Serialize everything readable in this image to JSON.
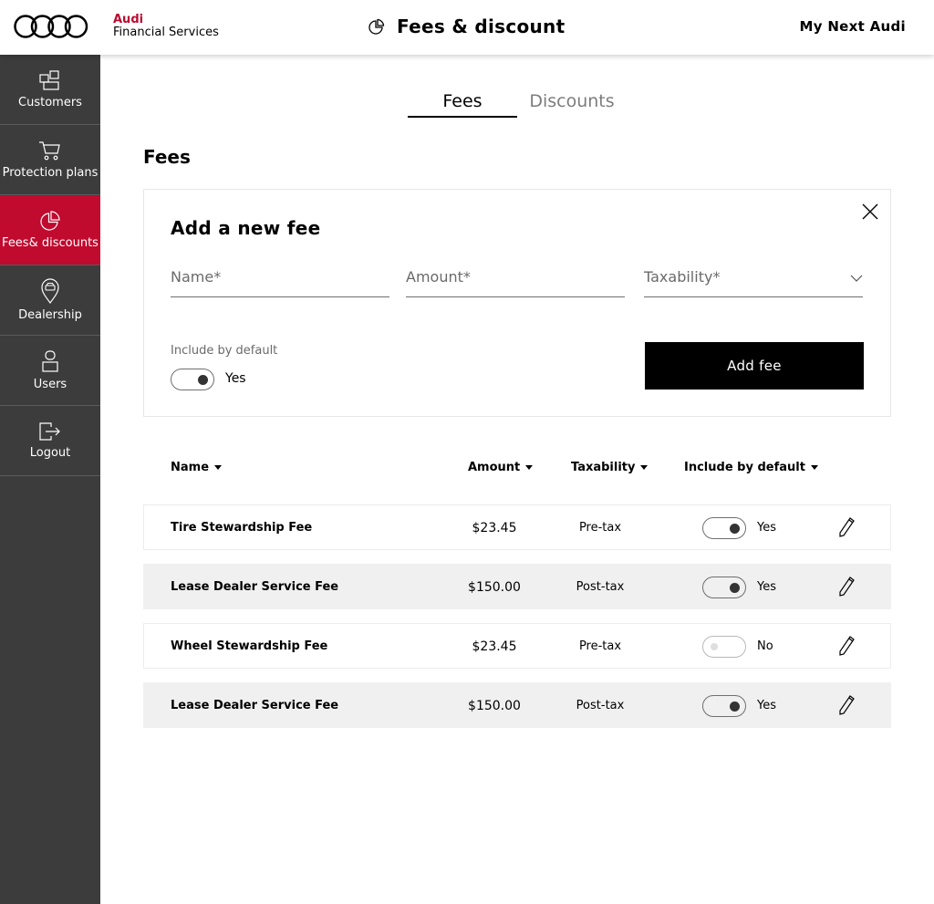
{
  "header": {
    "brand_line1": "Audi",
    "brand_line2": "Financial Services",
    "title": "Fees & discount",
    "title_icon": "pie-chart-icon",
    "right_link": "My Next Audi"
  },
  "sidebar": {
    "items": [
      {
        "label": "Customers",
        "icon": "customers-icon",
        "active": false
      },
      {
        "label": "Protection plans",
        "icon": "cart-icon",
        "active": false
      },
      {
        "label": "Fees& discounts",
        "icon": "pie-chart-icon",
        "active": true
      },
      {
        "label": "Dealership",
        "icon": "location-car-icon",
        "active": false
      },
      {
        "label": "Users",
        "icon": "user-icon",
        "active": false
      },
      {
        "label": "Logout",
        "icon": "logout-icon",
        "active": false
      }
    ]
  },
  "tabs": [
    {
      "label": "Fees",
      "active": true
    },
    {
      "label": "Discounts",
      "active": false
    }
  ],
  "section_title": "Fees",
  "form": {
    "title": "Add a new fee",
    "name_placeholder": "Name*",
    "amount_placeholder": "Amount*",
    "taxability_placeholder": "Taxability*",
    "include_label": "Include by default",
    "include_value": "Yes",
    "add_button": "Add fee"
  },
  "table": {
    "headers": [
      "Name",
      "Amount",
      "Taxability",
      "Include by default"
    ],
    "rows": [
      {
        "name": "Tire Stewardship Fee",
        "amount": "$23.45",
        "taxability": "Pre-tax",
        "include": "Yes",
        "on": true
      },
      {
        "name": "Lease Dealer Service Fee",
        "amount": "$150.00",
        "taxability": "Post-tax",
        "include": "Yes",
        "on": true
      },
      {
        "name": "Wheel Stewardship Fee",
        "amount": "$23.45",
        "taxability": "Pre-tax",
        "include": "No",
        "on": false
      },
      {
        "name": "Lease Dealer Service Fee",
        "amount": "$150.00",
        "taxability": "Post-tax",
        "include": "Yes",
        "on": true
      }
    ]
  },
  "colors": {
    "accent": "#c00a2e",
    "sidebar_bg": "#3c3c3c",
    "button_bg": "#000000"
  }
}
